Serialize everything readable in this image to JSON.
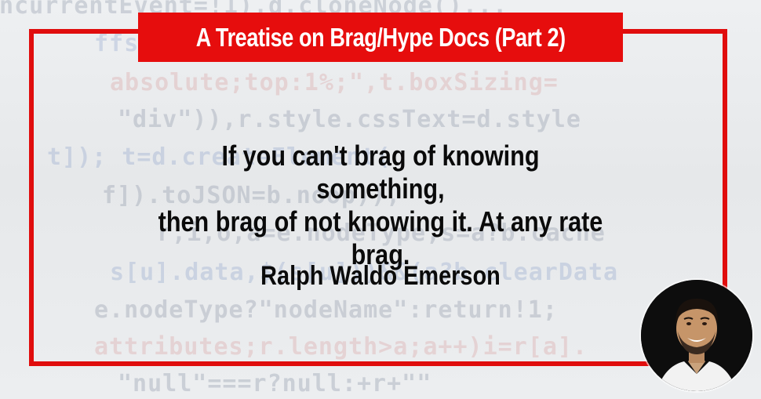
{
  "banner": {
    "title": "A Treatise on Brag/Hype Docs (Part 2)"
  },
  "quote": {
    "line1": "If you can't brag of knowing something,",
    "line2": "then brag of not knowing it. At any rate",
    "line3": "brag.",
    "author": "Ralph Waldo Emerson"
  },
  "colors": {
    "accent_red": "#e60d0d",
    "text": "#0a0a0a"
  },
  "avatar": {
    "icon": "person-photo-icon"
  }
}
